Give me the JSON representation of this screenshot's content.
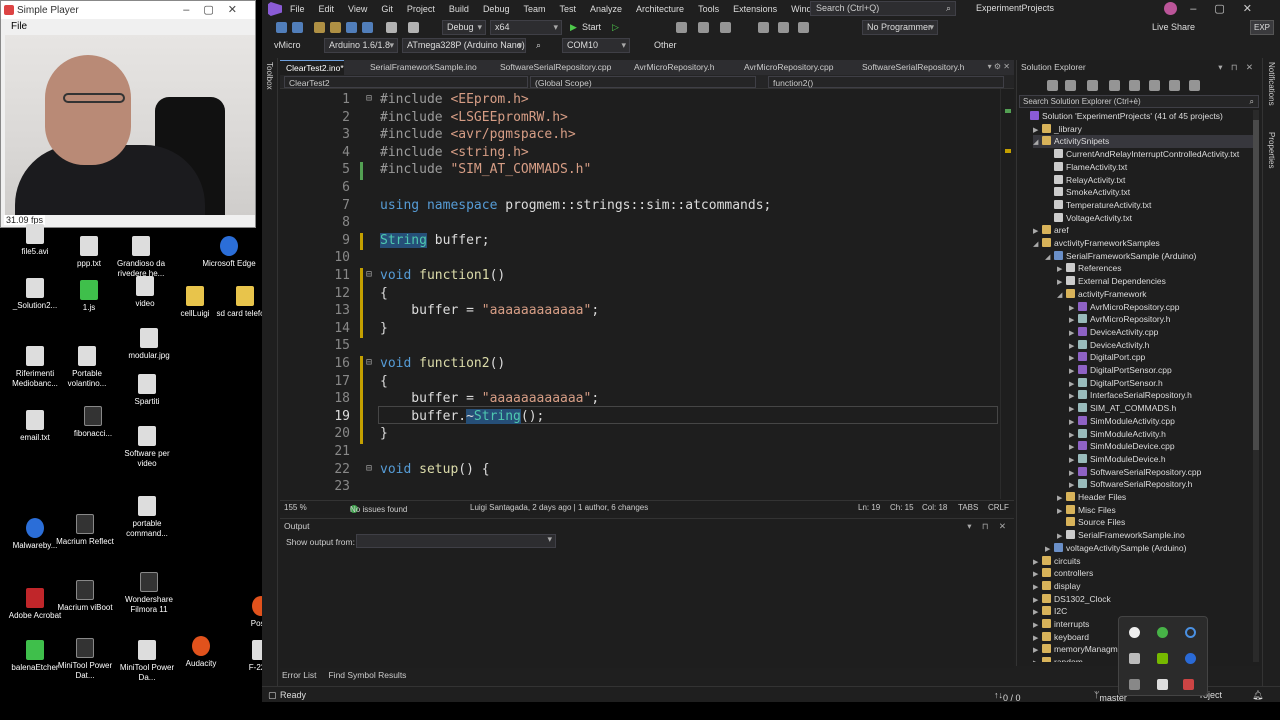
{
  "player": {
    "title": "Simple Player",
    "menu_file": "File",
    "fps": "31.09 fps"
  },
  "desktop_icons": [
    {
      "label": "file5.avi",
      "kind": "file"
    },
    {
      "label": "ppp.txt",
      "kind": "file"
    },
    {
      "label": "Grandioso da rivedere he...",
      "kind": "file"
    },
    {
      "label": "Microsoft Edge",
      "kind": "blue"
    },
    {
      "label": "_Solution2...",
      "kind": "file"
    },
    {
      "label": "1.js",
      "kind": "green"
    },
    {
      "label": "video",
      "kind": "file"
    },
    {
      "label": "cellLuigi",
      "kind": "folder"
    },
    {
      "label": "sd card telefono",
      "kind": "folder"
    },
    {
      "label": "modular.jpg",
      "kind": "file"
    },
    {
      "label": "Riferimenti Mediobanc...",
      "kind": "file"
    },
    {
      "label": "Portable volantino...",
      "kind": "file"
    },
    {
      "label": "Spartiti",
      "kind": "file"
    },
    {
      "label": "email.txt",
      "kind": "file"
    },
    {
      "label": "fibonacci...",
      "kind": "dark"
    },
    {
      "label": "Software per video",
      "kind": "file"
    },
    {
      "label": "portable command...",
      "kind": "file"
    },
    {
      "label": "Malwareby...",
      "kind": "blue"
    },
    {
      "label": "Macrium Reflect",
      "kind": "dark"
    },
    {
      "label": "Adobe Acrobat",
      "kind": "red"
    },
    {
      "label": "Macrium viBoot",
      "kind": "dark"
    },
    {
      "label": "Wondershare Filmora 11",
      "kind": "dark"
    },
    {
      "label": "Postn",
      "kind": "orange"
    },
    {
      "label": "balenaEtcher",
      "kind": "green"
    },
    {
      "label": "MiniTool Power Dat...",
      "kind": "dark"
    },
    {
      "label": "MiniTool Power Da...",
      "kind": "file"
    },
    {
      "label": "Audacity",
      "kind": "orange"
    },
    {
      "label": "F-22 R",
      "kind": "file"
    }
  ],
  "menu": [
    "File",
    "Edit",
    "View",
    "Git",
    "Project",
    "Build",
    "Debug",
    "Team",
    "Test",
    "Analyze",
    "Architecture",
    "Tools",
    "Extensions",
    "Window",
    "Help"
  ],
  "search_placeholder": "Search (Ctrl+Q)",
  "project_name": "ExperimentProjects",
  "toolbar": {
    "config": "Debug",
    "platform": "x64",
    "start": "Start",
    "programmer": "No Programmer",
    "live_share": "Live Share",
    "exp": "EXP"
  },
  "toolbar2": {
    "vmicro": "vMicro",
    "arduino": "Arduino 1.6/1.8",
    "board": "ATmega328P (Arduino Nano)",
    "port": "COM10",
    "other": "Other"
  },
  "toolbox_label": "Toolbox",
  "tabs": [
    {
      "label": "ClearTest2.ino*",
      "active": true
    },
    {
      "label": "SerialFrameworkSample.ino",
      "active": false
    },
    {
      "label": "SoftwareSerialRepository.cpp",
      "active": false
    },
    {
      "label": "AvrMicroRepository.h",
      "active": false
    },
    {
      "label": "AvrMicroRepository.cpp",
      "active": false
    },
    {
      "label": "SoftwareSerialRepository.h",
      "active": false
    }
  ],
  "nav": {
    "file": "ClearTest2",
    "scope": "(Global Scope)",
    "member": "function2()"
  },
  "code_lines": [
    {
      "n": "1",
      "parts": [
        [
          "pp",
          "#include "
        ],
        [
          "str",
          "<EEprom.h>"
        ]
      ]
    },
    {
      "n": "2",
      "parts": [
        [
          "pp",
          "#include "
        ],
        [
          "str",
          "<LSGEEpromRW.h>"
        ]
      ]
    },
    {
      "n": "3",
      "parts": [
        [
          "pp",
          "#include "
        ],
        [
          "str",
          "<avr/pgmspace.h>"
        ]
      ]
    },
    {
      "n": "4",
      "parts": [
        [
          "pp",
          "#include "
        ],
        [
          "str",
          "<string.h>"
        ]
      ]
    },
    {
      "n": "5",
      "parts": [
        [
          "pp",
          "#include "
        ],
        [
          "str",
          "\"SIM_AT_COMMADS.h\""
        ]
      ]
    },
    {
      "n": "6",
      "parts": []
    },
    {
      "n": "7",
      "parts": [
        [
          "kw",
          "using"
        ],
        [
          "",
          " "
        ],
        [
          "kw",
          "namespace"
        ],
        [
          "",
          " progmem::strings::sim::atcommands;"
        ]
      ]
    },
    {
      "n": "8",
      "parts": []
    },
    {
      "n": "9",
      "parts": [
        [
          "ty hl",
          "String"
        ],
        [
          "",
          " buffer;"
        ]
      ]
    },
    {
      "n": "10",
      "parts": []
    },
    {
      "n": "11",
      "parts": [
        [
          "kw",
          "void"
        ],
        [
          "",
          " "
        ],
        [
          "fn",
          "function1"
        ],
        [
          "",
          "()"
        ]
      ]
    },
    {
      "n": "12",
      "parts": [
        [
          "",
          "{"
        ]
      ]
    },
    {
      "n": "13",
      "parts": [
        [
          "",
          "    buffer = "
        ],
        [
          "str",
          "\"aaaaaaaaaaaa\""
        ],
        [
          "",
          ";"
        ]
      ]
    },
    {
      "n": "14",
      "parts": [
        [
          "",
          "}"
        ]
      ]
    },
    {
      "n": "15",
      "parts": []
    },
    {
      "n": "16",
      "parts": [
        [
          "kw",
          "void"
        ],
        [
          "",
          " "
        ],
        [
          "fn",
          "function2"
        ],
        [
          "",
          "()"
        ]
      ]
    },
    {
      "n": "17",
      "parts": [
        [
          "",
          "{"
        ]
      ]
    },
    {
      "n": "18",
      "parts": [
        [
          "",
          "    buffer = "
        ],
        [
          "str",
          "\"aaaaaaaaaaaa\""
        ],
        [
          "",
          ";"
        ]
      ]
    },
    {
      "n": "19",
      "parts": [
        [
          "",
          "    buffer."
        ],
        [
          "hl",
          "~"
        ],
        [
          "ty hl",
          "String"
        ],
        [
          "",
          "();"
        ]
      ]
    },
    {
      "n": "20",
      "parts": [
        [
          "",
          "}"
        ]
      ]
    },
    {
      "n": "21",
      "parts": []
    },
    {
      "n": "22",
      "parts": [
        [
          "kw",
          "void"
        ],
        [
          "",
          " "
        ],
        [
          "fn",
          "setup"
        ],
        [
          "",
          "() {"
        ]
      ]
    },
    {
      "n": "23",
      "parts": []
    }
  ],
  "editor_status": {
    "zoom": "155 %",
    "issues": "No issues found",
    "blame": "Luigi Santagada, 2 days ago | 1 author, 6 changes",
    "ln": "Ln: 19",
    "ch": "Ch: 15",
    "col": "Col: 18",
    "tabs": "TABS",
    "eol": "CRLF"
  },
  "output": {
    "title": "Output",
    "show_from": "Show output from:"
  },
  "bottom_tabs": [
    "Error List",
    "Find Symbol Results"
  ],
  "solution_explorer": {
    "title": "Solution Explorer",
    "search": "Search Solution Explorer (Ctrl+è)",
    "items": [
      {
        "label": "Solution 'ExperimentProjects' (41 of 45 projects)",
        "depth": 0,
        "arrow": "",
        "icon": "sol"
      },
      {
        "label": "_library",
        "depth": 1,
        "arrow": "▶",
        "icon": "folder"
      },
      {
        "label": "ActivitySnipets",
        "depth": 1,
        "arrow": "◢",
        "icon": "folder",
        "selected": true
      },
      {
        "label": "CurrentAndRelayInterruptControlledActivity.txt",
        "depth": 2,
        "arrow": "",
        "icon": "file"
      },
      {
        "label": "FlameActivity.txt",
        "depth": 2,
        "arrow": "",
        "icon": "file"
      },
      {
        "label": "RelayActivity.txt",
        "depth": 2,
        "arrow": "",
        "icon": "file"
      },
      {
        "label": "SmokeActivity.txt",
        "depth": 2,
        "arrow": "",
        "icon": "file"
      },
      {
        "label": "TemperatureActivity.txt",
        "depth": 2,
        "arrow": "",
        "icon": "file"
      },
      {
        "label": "VoltageActivity.txt",
        "depth": 2,
        "arrow": "",
        "icon": "file"
      },
      {
        "label": "aref",
        "depth": 1,
        "arrow": "▶",
        "icon": "folder"
      },
      {
        "label": "avctivityFrameworkSamples",
        "depth": 1,
        "arrow": "◢",
        "icon": "folder"
      },
      {
        "label": "SerialFrameworkSample (Arduino)",
        "depth": 2,
        "arrow": "◢",
        "icon": "proj"
      },
      {
        "label": "References",
        "depth": 3,
        "arrow": "▶",
        "icon": "file"
      },
      {
        "label": "External Dependencies",
        "depth": 3,
        "arrow": "▶",
        "icon": "file"
      },
      {
        "label": "activityFramework",
        "depth": 3,
        "arrow": "◢",
        "icon": "folder"
      },
      {
        "label": "AvrMicroRepository.cpp",
        "depth": 4,
        "arrow": "▶",
        "icon": "cpp"
      },
      {
        "label": "AvrMicroRepository.h",
        "depth": 4,
        "arrow": "▶",
        "icon": "h"
      },
      {
        "label": "DeviceActivity.cpp",
        "depth": 4,
        "arrow": "▶",
        "icon": "cpp"
      },
      {
        "label": "DeviceActivity.h",
        "depth": 4,
        "arrow": "▶",
        "icon": "h"
      },
      {
        "label": "DigitalPort.cpp",
        "depth": 4,
        "arrow": "▶",
        "icon": "cpp"
      },
      {
        "label": "DigitalPortSensor.cpp",
        "depth": 4,
        "arrow": "▶",
        "icon": "cpp"
      },
      {
        "label": "DigitalPortSensor.h",
        "depth": 4,
        "arrow": "▶",
        "icon": "h"
      },
      {
        "label": "InterfaceSerialRepository.h",
        "depth": 4,
        "arrow": "▶",
        "icon": "h"
      },
      {
        "label": "SIM_AT_COMMADS.h",
        "depth": 4,
        "arrow": "▶",
        "icon": "h"
      },
      {
        "label": "SimModuleActivity.cpp",
        "depth": 4,
        "arrow": "▶",
        "icon": "cpp"
      },
      {
        "label": "SimModuleActivity.h",
        "depth": 4,
        "arrow": "▶",
        "icon": "h"
      },
      {
        "label": "SimModuleDevice.cpp",
        "depth": 4,
        "arrow": "▶",
        "icon": "cpp"
      },
      {
        "label": "SimModuleDevice.h",
        "depth": 4,
        "arrow": "▶",
        "icon": "h"
      },
      {
        "label": "SoftwareSerialRepository.cpp",
        "depth": 4,
        "arrow": "▶",
        "icon": "cpp"
      },
      {
        "label": "SoftwareSerialRepository.h",
        "depth": 4,
        "arrow": "▶",
        "icon": "h"
      },
      {
        "label": "Header Files",
        "depth": 3,
        "arrow": "▶",
        "icon": "folder"
      },
      {
        "label": "Misc Files",
        "depth": 3,
        "arrow": "▶",
        "icon": "folder"
      },
      {
        "label": "Source Files",
        "depth": 3,
        "arrow": "",
        "icon": "folder"
      },
      {
        "label": "SerialFrameworkSample.ino",
        "depth": 3,
        "arrow": "▶",
        "icon": "file"
      },
      {
        "label": "voltageActivitySample (Arduino)",
        "depth": 2,
        "arrow": "▶",
        "icon": "proj"
      },
      {
        "label": "circuits",
        "depth": 1,
        "arrow": "▶",
        "icon": "folder"
      },
      {
        "label": "controllers",
        "depth": 1,
        "arrow": "▶",
        "icon": "folder"
      },
      {
        "label": "display",
        "depth": 1,
        "arrow": "▶",
        "icon": "folder"
      },
      {
        "label": "DS1302_Clock",
        "depth": 1,
        "arrow": "▶",
        "icon": "folder"
      },
      {
        "label": "I2C",
        "depth": 1,
        "arrow": "▶",
        "icon": "folder"
      },
      {
        "label": "interrupts",
        "depth": 1,
        "arrow": "▶",
        "icon": "folder"
      },
      {
        "label": "keyboard",
        "depth": 1,
        "arrow": "▶",
        "icon": "folder"
      },
      {
        "label": "memoryManagmen",
        "depth": 1,
        "arrow": "▶",
        "icon": "folder"
      },
      {
        "label": "random",
        "depth": 1,
        "arrow": "▶",
        "icon": "folder"
      }
    ]
  },
  "right_strip": [
    "Notifications",
    "Properties"
  ],
  "status": {
    "ready": "Ready",
    "counts": "0 / 0",
    "branch": "master",
    "project": "roject"
  }
}
